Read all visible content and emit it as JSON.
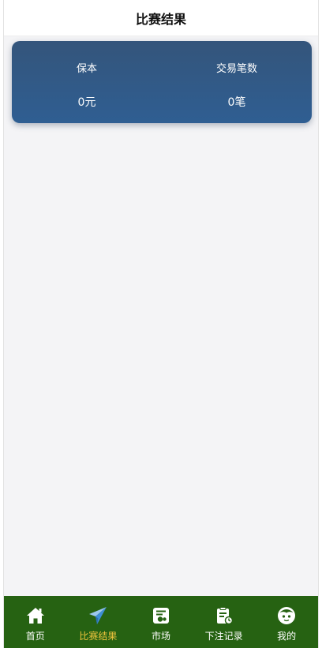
{
  "header": {
    "title": "比赛结果"
  },
  "stats": [
    {
      "label": "保本",
      "value": "0元"
    },
    {
      "label": "交易笔数",
      "value": "0笔"
    }
  ],
  "tabbar": {
    "active_color": "#f2c53d",
    "background": "#266212",
    "items": [
      {
        "label": "首页",
        "icon": "home-icon"
      },
      {
        "label": "比赛结果",
        "icon": "paper-plane-icon",
        "active": true
      },
      {
        "label": "市场",
        "icon": "market-icon"
      },
      {
        "label": "下注记录",
        "icon": "bet-record-icon"
      },
      {
        "label": "我的",
        "icon": "profile-face-icon"
      }
    ]
  }
}
